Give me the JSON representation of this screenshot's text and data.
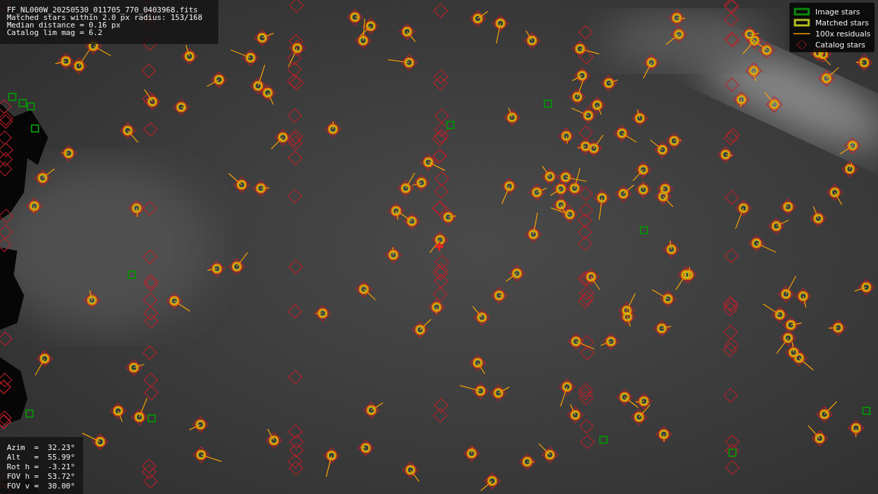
{
  "info_box": {
    "lines": [
      "FF_NL000W_20250530_011705_770_0403968.fits",
      "Matched stars within 2.0 px radius: 153/168",
      "Median distance = 0.16 px",
      "Catalog lim mag = 6.2"
    ]
  },
  "pointing_box": {
    "lines": [
      "Azim  =  32.23°",
      "Alt   =  55.99°",
      "Rot h =  -3.21°",
      "FOV h =  53.72°",
      "FOV v =  30.00°"
    ]
  },
  "legend": [
    {
      "label": "Image stars"
    },
    {
      "kind": "matched",
      "label": "Matched stars"
    },
    {
      "kind": "residual",
      "label": "100x residuals"
    },
    {
      "kind": "catalog",
      "label": "Catalog stars"
    }
  ]
}
